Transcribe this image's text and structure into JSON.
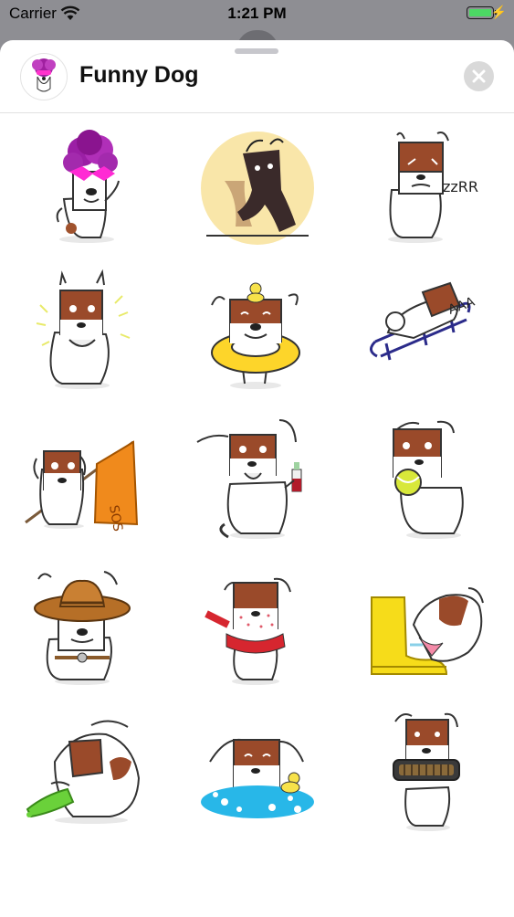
{
  "status_bar": {
    "carrier": "Carrier",
    "time": "1:21 PM",
    "battery_level": 1.0,
    "battery_color": "#4cd964"
  },
  "header": {
    "title": "Funny Dog",
    "icon": "funny-dog-app-icon",
    "close_icon": "close-icon"
  },
  "stickers": [
    {
      "name": "afro-sunglasses-dog"
    },
    {
      "name": "shadow-dancing-dog"
    },
    {
      "name": "snoring-dog",
      "text": "zzRR"
    },
    {
      "name": "shocked-dog"
    },
    {
      "name": "swim-ring-duck-dog"
    },
    {
      "name": "sledding-dog",
      "text": "AAA"
    },
    {
      "name": "sos-flag-dog",
      "text": "SOS"
    },
    {
      "name": "drinking-dog"
    },
    {
      "name": "tennis-ball-dog"
    },
    {
      "name": "cowboy-dog"
    },
    {
      "name": "sick-scarf-dog"
    },
    {
      "name": "rain-boot-dog"
    },
    {
      "name": "vomiting-dog"
    },
    {
      "name": "bathing-dog"
    },
    {
      "name": "harmonica-dog"
    }
  ]
}
